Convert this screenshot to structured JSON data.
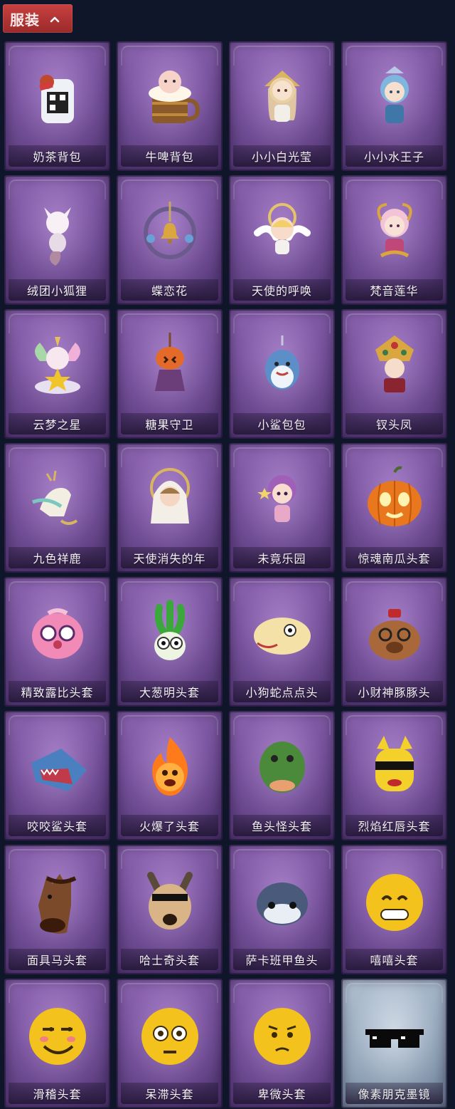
{
  "header": {
    "tab_label": "服装",
    "chevron_icon": "chevron-up-icon"
  },
  "colors": {
    "tab_red": "#b83636",
    "background": "#10162a",
    "card_purple": "#7a56a0",
    "card_silver": "#a2b3c6"
  },
  "items": [
    {
      "label": "奶茶背包",
      "icon": "milk-tea-backpack-icon",
      "style": "purple"
    },
    {
      "label": "牛啤背包",
      "icon": "beer-cow-backpack-icon",
      "style": "purple"
    },
    {
      "label": "小小白光莹",
      "icon": "white-light-doll-icon",
      "style": "purple"
    },
    {
      "label": "小小水王子",
      "icon": "water-prince-doll-icon",
      "style": "purple"
    },
    {
      "label": "绒团小狐狸",
      "icon": "fox-pendant-icon",
      "style": "purple"
    },
    {
      "label": "蝶恋花",
      "icon": "bell-wreath-icon",
      "style": "purple"
    },
    {
      "label": "天使的呼唤",
      "icon": "angel-doll-icon",
      "style": "purple"
    },
    {
      "label": "梵音莲华",
      "icon": "lotus-doll-icon",
      "style": "purple"
    },
    {
      "label": "云梦之星",
      "icon": "unicorn-star-icon",
      "style": "purple"
    },
    {
      "label": "糖果守卫",
      "icon": "pumpkin-guard-icon",
      "style": "purple"
    },
    {
      "label": "小鲨包包",
      "icon": "shark-bag-icon",
      "style": "purple"
    },
    {
      "label": "钗头凤",
      "icon": "phoenix-crown-icon",
      "style": "purple"
    },
    {
      "label": "九色祥鹿",
      "icon": "deer-pendant-icon",
      "style": "purple"
    },
    {
      "label": "天使消失的年",
      "icon": "angel-girl-icon",
      "style": "purple"
    },
    {
      "label": "未竟乐园",
      "icon": "paradise-doll-icon",
      "style": "purple"
    },
    {
      "label": "惊魂南瓜头套",
      "icon": "pumpkin-head-icon",
      "style": "purple"
    },
    {
      "label": "精致露比头套",
      "icon": "pink-beaver-head-icon",
      "style": "purple"
    },
    {
      "label": "大葱明头套",
      "icon": "scallion-head-icon",
      "style": "purple"
    },
    {
      "label": "小狗蛇点点头",
      "icon": "snake-head-icon",
      "style": "purple"
    },
    {
      "label": "小财神豚豚头",
      "icon": "capybara-head-icon",
      "style": "purple"
    },
    {
      "label": "咬咬鲨头套",
      "icon": "shark-head-icon",
      "style": "purple"
    },
    {
      "label": "火爆了头套",
      "icon": "fire-head-icon",
      "style": "purple"
    },
    {
      "label": "鱼头怪头套",
      "icon": "fish-head-icon",
      "style": "purple"
    },
    {
      "label": "烈焰红唇头套",
      "icon": "yellow-mask-head-icon",
      "style": "purple"
    },
    {
      "label": "面具马头套",
      "icon": "horse-head-icon",
      "style": "purple"
    },
    {
      "label": "哈士奇头套",
      "icon": "husky-head-icon",
      "style": "purple"
    },
    {
      "label": "萨卡班甲鱼头",
      "icon": "fish-round-head-icon",
      "style": "purple"
    },
    {
      "label": "嘻嘻头套",
      "icon": "grin-emoji-head-icon",
      "style": "purple"
    },
    {
      "label": "滑稽头套",
      "icon": "funny-emoji-head-icon",
      "style": "purple"
    },
    {
      "label": "呆滞头套",
      "icon": "dazed-emoji-head-icon",
      "style": "purple"
    },
    {
      "label": "卑微头套",
      "icon": "humble-emoji-head-icon",
      "style": "purple"
    },
    {
      "label": "像素朋克墨镜",
      "icon": "pixel-sunglasses-icon",
      "style": "silver"
    }
  ]
}
